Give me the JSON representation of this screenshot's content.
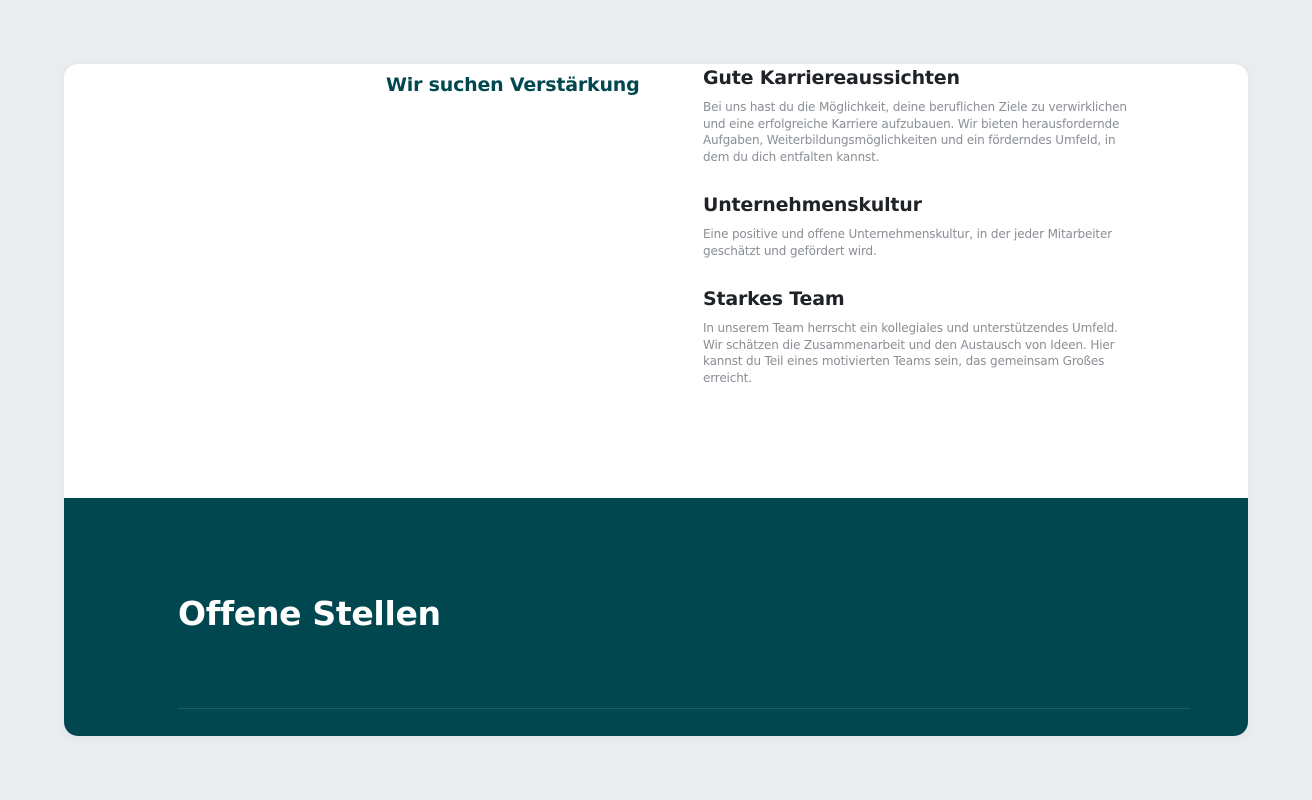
{
  "recruit": {
    "heading": "Wir suchen Verstärkung"
  },
  "features": [
    {
      "title": "Gute Karriereaussichten",
      "text": "Bei uns hast du die Möglichkeit, deine beruflichen Ziele zu verwirklichen und eine erfolgreiche Karriere aufzubauen. Wir bieten herausfordernde Aufgaben, Weiterbildungsmöglichkeiten und ein förderndes Umfeld, in dem du dich entfalten kannst."
    },
    {
      "title": "Unternehmenskultur",
      "text": "Eine positive und offene Unternehmenskultur, in der jeder Mitarbeiter geschätzt und gefördert wird."
    },
    {
      "title": "Starkes Team",
      "text": "In unserem Team herrscht ein kollegiales und unterstützendes Umfeld. Wir schätzen die Zusammenarbeit und den Austausch von Ideen. Hier kannst du Teil eines motivierten Teams sein, das gemeinsam Großes erreicht."
    }
  ],
  "jobs": {
    "title": "Offene Stellen"
  },
  "colors": {
    "brand_teal": "#00474f",
    "page_background": "#eaecef",
    "body_text": "#8a8f95",
    "heading_text": "#1f2328"
  }
}
